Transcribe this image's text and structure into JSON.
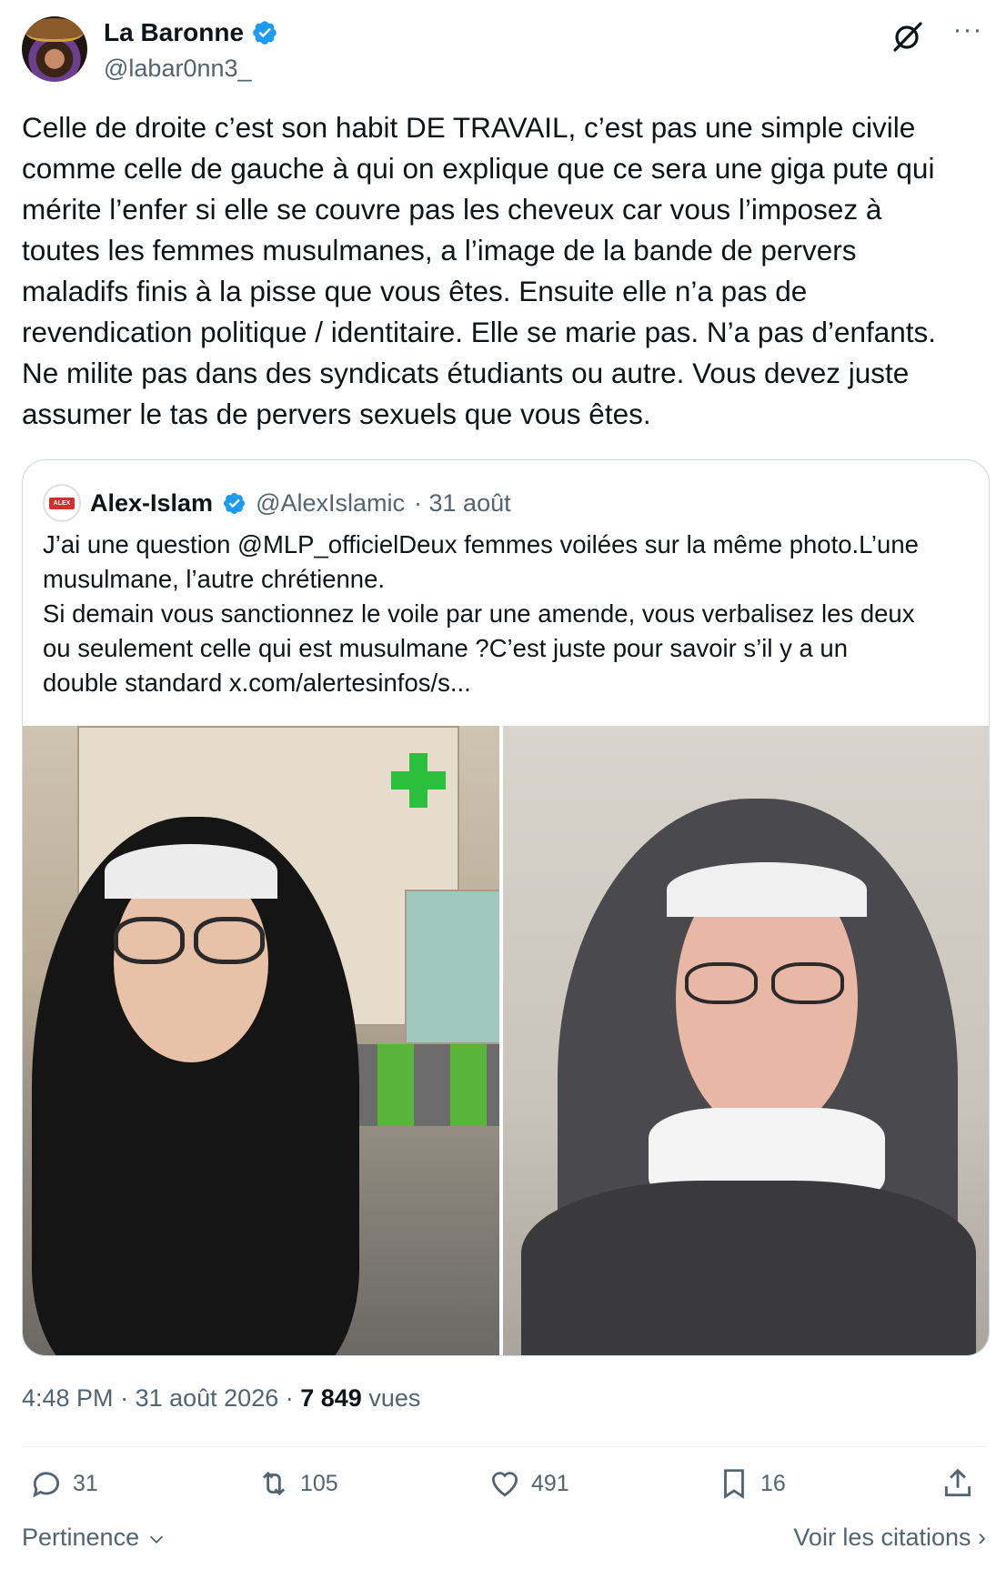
{
  "author": {
    "display_name": "La Baronne",
    "handle": "@labar0nn3_",
    "verified": true
  },
  "header_icons": [
    "grok-icon",
    "more-icon"
  ],
  "more_glyph": "···",
  "post_text": "Celle de droite c’est son habit DE TRAVAIL, c’est pas une simple civile\ncomme celle de gauche à qui on explique que ce sera une giga pute qui\nmérite l’enfer si elle se couvre pas les cheveux car vous l’imposez à\ntoutes les femmes musulmanes, a l’image de la bande de pervers\nmaladifs finis à la pisse que vous êtes. Ensuite elle n’a pas de\nrevendication politique / identitaire. Elle se marie pas. N’a pas d’enfants.\nNe milite pas dans des syndicats étudiants ou autre. Vous devez juste\nassumer le tas de pervers sexuels que vous êtes.",
  "quote": {
    "display_name": "Alex-Islam",
    "handle": "@AlexIslamic",
    "date": "· 31 août",
    "avatar_text": "ALEX ISLAM",
    "text": "J’ai une question @MLP_officielDeux femmes voilées sur la même photo.L’une\nmusulmane, l’autre chrétienne.\nSi demain vous sanctionnez le voile par une amende, vous verbalisez les deux\nou seulement celle qui est musulmane ?C’est juste pour savoir s’il y a un\ndouble standard  x.com/alertesinfos/s...",
    "images": [
      "woman-hijab-street-photo",
      "nun-habit-photo"
    ]
  },
  "meta": {
    "time": "4:48 PM",
    "date": "· 31 août 2026 ·",
    "views_count": "7 849",
    "views_label": "vues"
  },
  "actions": {
    "replies": "31",
    "reposts": "105",
    "likes": "491",
    "bookmarks": "16"
  },
  "footer": {
    "sort_label": "Pertinence",
    "quotes_label": "Voir les citations ›"
  },
  "colors": {
    "text": "#0f1419",
    "secondary": "#536471",
    "verified": "#1d9bf0",
    "border": "#cfd9de"
  }
}
